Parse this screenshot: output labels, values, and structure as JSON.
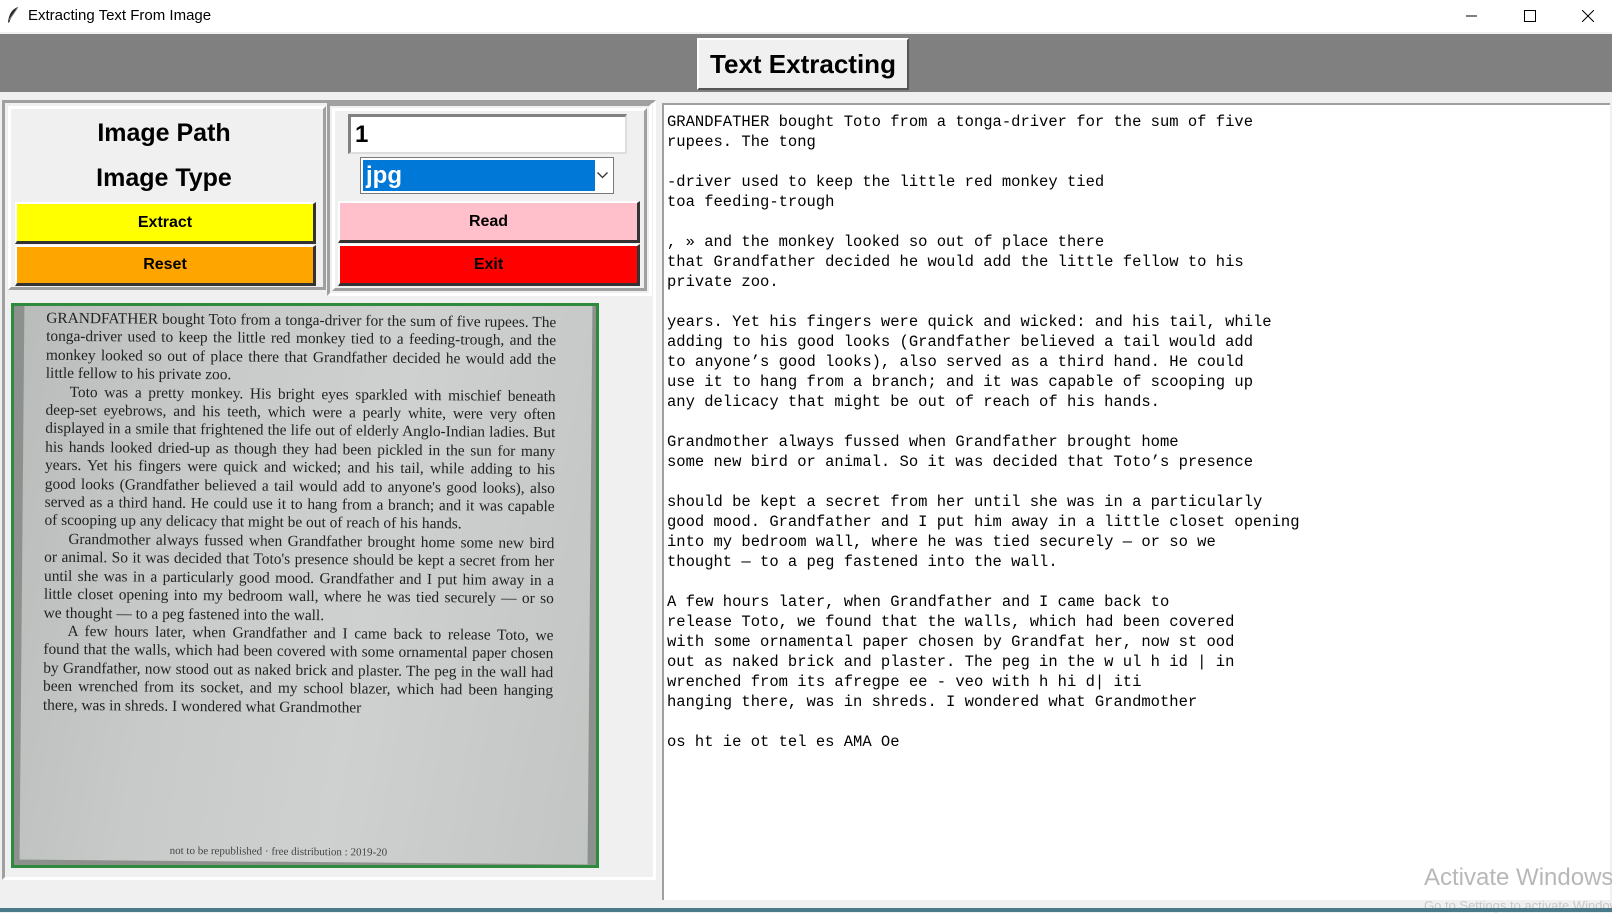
{
  "window": {
    "title": "Extracting Text From Image",
    "controls": [
      "minimize",
      "maximize",
      "close"
    ]
  },
  "header": {
    "title": "Text Extracting"
  },
  "form": {
    "image_path_label": "Image Path",
    "image_type_label": "Image Type",
    "image_path_value": "1",
    "image_type_value": "jpg"
  },
  "buttons": {
    "extract": {
      "label": "Extract",
      "color": "#ffff00"
    },
    "read": {
      "label": "Read",
      "color": "#ffc0cb"
    },
    "reset": {
      "label": "Reset",
      "color": "#ffa500"
    },
    "exit": {
      "label": "Exit",
      "color": "#ff0000"
    }
  },
  "photo": {
    "paragraphs": [
      "GRANDFATHER bought Toto from a tonga-driver for the sum of five rupees. The tonga-driver used to keep the little red monkey tied to a feeding-trough, and the monkey looked so out of place there that Grandfather decided he would add the little fellow to his private zoo.",
      "Toto was a pretty monkey. His bright eyes sparkled with mischief beneath deep-set eyebrows, and his teeth, which were a pearly white, were very often displayed in a smile that frightened the life out of elderly Anglo-Indian ladies. But his hands looked dried-up as though they had been pickled in the sun for many years. Yet his fingers were quick and wicked; and his tail, while adding to his good looks (Grandfather believed a tail would add to anyone's good looks), also served as a third hand. He could use it to hang from a branch; and it was capable of scooping up any delicacy that might be out of reach of his hands.",
      "Grandmother always fussed when Grandfather brought home some new bird or animal. So it was decided that Toto's presence should be kept a secret from her until she was in a particularly good mood. Grandfather and I put him away in a little closet opening into my bedroom wall, where he was tied securely — or so we thought — to a peg fastened into the wall.",
      "A few hours later, when Grandfather and I came back to release Toto, we found that the walls, which had been covered with some ornamental paper chosen by Grandfather, now stood out as naked brick and plaster. The peg in the wall had been wrenched from its socket, and my school blazer, which had been hanging there, was in shreds. I wondered what Grandmother"
    ],
    "footer": "not to be republished · free distribution : 2019-20"
  },
  "output": {
    "text": "GRANDFATHER bought Toto from a tonga-driver for the sum of five\nrupees. The tong\n\n-driver used to keep the little red monkey tied\ntoa feeding-trough\n\n, » and the monkey looked so out of place there\nthat Grandfather decided he would add the little fellow to his\nprivate zoo.\n\nyears. Yet his fingers were quick and wicked: and his tail, while\nadding to his good looks (Grandfather believed a tail would add\nto anyone’s good looks), also served as a third hand. He could\nuse it to hang from a branch; and it was capable of scooping up\nany delicacy that might be out of reach of his hands.\n\nGrandmother always fussed when Grandfather brought home\nsome new bird or animal. So it was decided that Toto’s presence\n\nshould be kept a secret from her until she was in a particularly\ngood mood. Grandfather and I put him away in a little closet opening\ninto my bedroom wall, where he was tied securely — or so we\nthought — to a peg fastened into the wall.\n\nA few hours later, when Grandfather and I came back to\nrelease Toto, we found that the walls, which had been covered\nwith some ornamental paper chosen by Grandfat her, now st ood\nout as naked brick and plaster. The peg in the w ul h id | in\nwrenched from its afregpe ee - veo with h hi d| iti\nhanging there, was in shreds. I wondered what Grandmother\n\nos ht ie ot tel es AMA Oe"
  },
  "watermark": {
    "title": "Activate Windows",
    "subtitle": "Go to Settings to activate Windows."
  },
  "colors": {
    "header_band": "#808080",
    "image_border": "#2e8b3d",
    "selection": "#0078d7"
  }
}
